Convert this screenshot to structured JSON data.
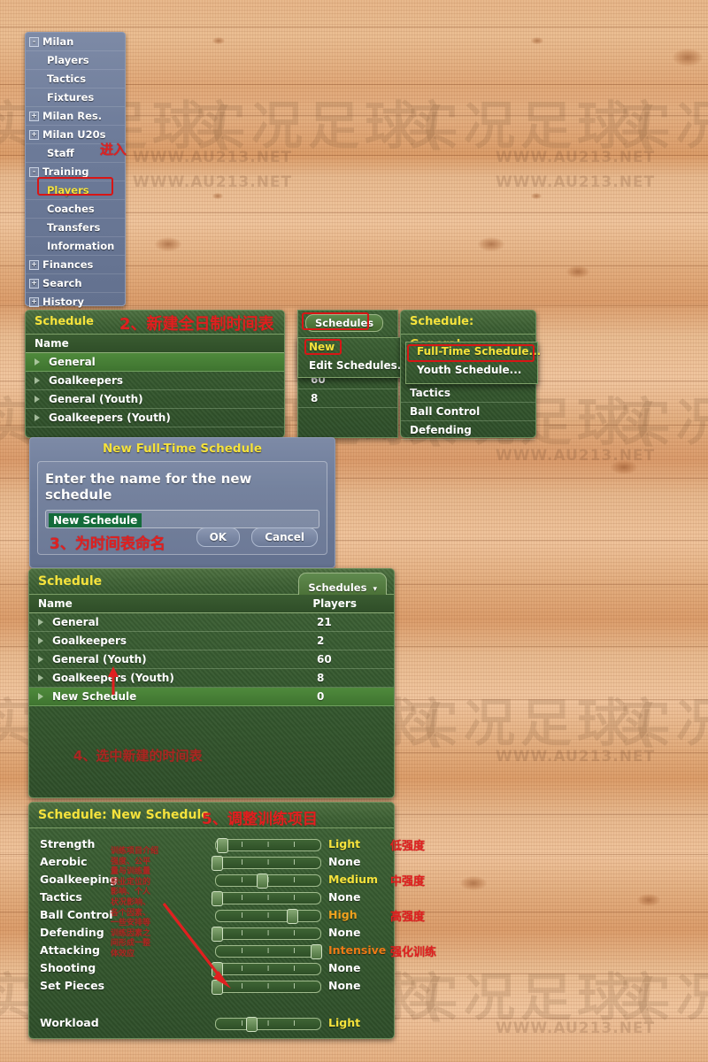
{
  "background": {
    "watermark_big": "实况足球(",
    "watermark_small": "WWW.AU213.NET"
  },
  "sidebar": {
    "items": [
      {
        "label": "Milan",
        "toggle": "-",
        "level": 1,
        "selected": false
      },
      {
        "label": "Players",
        "toggle": "",
        "level": 2,
        "selected": false
      },
      {
        "label": "Tactics",
        "toggle": "",
        "level": 2,
        "selected": false
      },
      {
        "label": "Fixtures",
        "toggle": "",
        "level": 2,
        "selected": false
      },
      {
        "label": "Milan Res.",
        "toggle": "+",
        "level": 1,
        "selected": false
      },
      {
        "label": "Milan U20s",
        "toggle": "+",
        "level": 1,
        "selected": false
      },
      {
        "label": "Staff",
        "toggle": "",
        "level": 2,
        "selected": false
      },
      {
        "label": "Training",
        "toggle": "-",
        "level": 1,
        "selected": false
      },
      {
        "label": "Players",
        "toggle": "",
        "level": 2,
        "selected": true
      },
      {
        "label": "Coaches",
        "toggle": "",
        "level": 2,
        "selected": false
      },
      {
        "label": "Transfers",
        "toggle": "",
        "level": 2,
        "selected": false
      },
      {
        "label": "Information",
        "toggle": "",
        "level": 2,
        "selected": false
      },
      {
        "label": "Finances",
        "toggle": "+",
        "level": 1,
        "selected": false
      },
      {
        "label": "Search",
        "toggle": "+",
        "level": 1,
        "selected": false
      },
      {
        "label": "History",
        "toggle": "+",
        "level": 1,
        "selected": false
      }
    ],
    "annotation_step1": "进入"
  },
  "schedule_panel_top": {
    "title": "Schedule",
    "annotation": "2、新建全日制时间表",
    "schedules_button": "Schedules",
    "columns": [
      "Name",
      ""
    ],
    "rows": [
      {
        "name": "General",
        "players": "",
        "selected": true
      },
      {
        "name": "Goalkeepers",
        "players": "–",
        "selected": false
      },
      {
        "name": "General (Youth)",
        "players": "60",
        "selected": false
      },
      {
        "name": "Goalkeepers (Youth)",
        "players": "8",
        "selected": false
      }
    ]
  },
  "schedules_menu": {
    "items": [
      {
        "label": "New",
        "highlighted": true,
        "has_submenu": true
      },
      {
        "label": "Edit Schedules...",
        "highlighted": false,
        "has_submenu": false
      }
    ]
  },
  "new_submenu": {
    "items": [
      {
        "label": "Full-Time Schedule...",
        "highlighted": true
      },
      {
        "label": "Youth Schedule...",
        "highlighted": false
      }
    ]
  },
  "schedule_general_panel": {
    "title": "Schedule: General",
    "items": [
      "Tactics",
      "Ball Control",
      "Defending"
    ]
  },
  "dialog": {
    "title": "New Full-Time Schedule",
    "prompt": "Enter the name for the new schedule",
    "input_value": "New Schedule",
    "input_placeholder": "New Schedule",
    "annotation": "3、为时间表命名",
    "ok_label": "OK",
    "cancel_label": "Cancel"
  },
  "schedule_panel_bottom": {
    "title": "Schedule",
    "schedules_button": "Schedules",
    "dropdown_caret": "▾",
    "columns": [
      "Name",
      "Players"
    ],
    "rows": [
      {
        "name": "General",
        "players": "21",
        "selected": false
      },
      {
        "name": "Goalkeepers",
        "players": "2",
        "selected": false
      },
      {
        "name": "General (Youth)",
        "players": "60",
        "selected": false
      },
      {
        "name": "Goalkeepers (Youth)",
        "players": "8",
        "selected": false
      },
      {
        "name": "New Schedule",
        "players": "0",
        "selected": true
      }
    ],
    "annotation": "4、选中新建的时间表"
  },
  "training_panel": {
    "title": "Schedule: New Schedule",
    "annotation": "5、调整训练项目",
    "side_note": "训练项目介绍\n强度、公平\n量与训练量\n职业定位的\n影响、个人\n状况影响、\n各个因素、\n一些安排等\n训练因素之\n间形成一整\n体效应",
    "categories": [
      {
        "label": "Strength",
        "value": "Light",
        "value_class": "v-light",
        "knob_pct": 5,
        "note": "低强度"
      },
      {
        "label": "Aerobic",
        "value": "None",
        "value_class": "v-none",
        "knob_pct": 0,
        "note": ""
      },
      {
        "label": "Goalkeeping",
        "value": "Medium",
        "value_class": "v-medium",
        "knob_pct": 43,
        "note": "中强度"
      },
      {
        "label": "Tactics",
        "value": "None",
        "value_class": "v-none",
        "knob_pct": 0,
        "note": ""
      },
      {
        "label": "Ball Control",
        "value": "High",
        "value_class": "v-high",
        "knob_pct": 72,
        "note": "高强度"
      },
      {
        "label": "Defending",
        "value": "None",
        "value_class": "v-none",
        "knob_pct": 0,
        "note": ""
      },
      {
        "label": "Attacking",
        "value": "Intensive",
        "value_class": "v-intensive",
        "knob_pct": 95,
        "note": "强化训练"
      },
      {
        "label": "Shooting",
        "value": "None",
        "value_class": "v-none",
        "knob_pct": 0,
        "note": ""
      },
      {
        "label": "Set Pieces",
        "value": "None",
        "value_class": "v-none",
        "knob_pct": 0,
        "note": ""
      }
    ],
    "workload": {
      "label": "Workload",
      "value": "Light",
      "value_class": "v-light",
      "knob_pct": 33
    }
  }
}
